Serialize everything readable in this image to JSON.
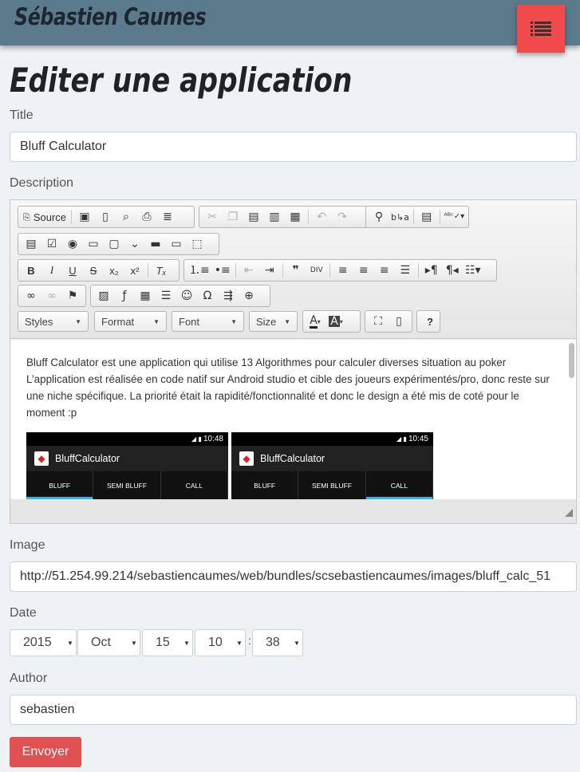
{
  "header": {
    "site_title": "Sébastien Caumes",
    "menu_icon": "list-icon"
  },
  "page_title": "Editer une application",
  "form": {
    "title_label": "Title",
    "title_value": "Bluff Calculator",
    "description_label": "Description",
    "image_label": "Image",
    "image_value": "http://51.254.99.214/sebastiencaumes/web/bundles/scsebastiencaumes/images/bluff_calc_51",
    "date_label": "Date",
    "date": {
      "year": "2015",
      "month": "Oct",
      "day": "15",
      "hour": "10",
      "minute": "38",
      "separator": ":"
    },
    "author_label": "Author",
    "author_value": "sebastien",
    "submit_label": "Envoyer"
  },
  "editor": {
    "source_label": "Source",
    "styles_label": "Styles",
    "format_label": "Format",
    "font_label": "Font",
    "size_label": "Size",
    "help_label": "?",
    "content_text": "Bluff Calculator est une application qui utilise 13 Algorithmes pour calculer diverses situation au poker L’application est réalisée en code natif sur Android studio et cible des joueurs expérimentés/pro, donc reste sur une niche spécifique. La priorité était la rapidité/fonctionnalité et donc le design a été mis de coté pour le moment :p",
    "screenshots": [
      {
        "time": "10:48",
        "app_name": "BluffCalculator",
        "tabs": [
          "BLUFF",
          "SEMI BLUFF",
          "CALL"
        ],
        "active_tab": 0
      },
      {
        "time": "10:45",
        "app_name": "BluffCalculator",
        "tabs": [
          "BLUFF",
          "SEMI BLUFF",
          "CALL"
        ],
        "active_tab": 2
      }
    ]
  },
  "colors": {
    "header_bg": "#5b7a8b",
    "accent": "#f04a4a",
    "submit_bg": "#e05252",
    "page_bg": "#eef2f5"
  }
}
